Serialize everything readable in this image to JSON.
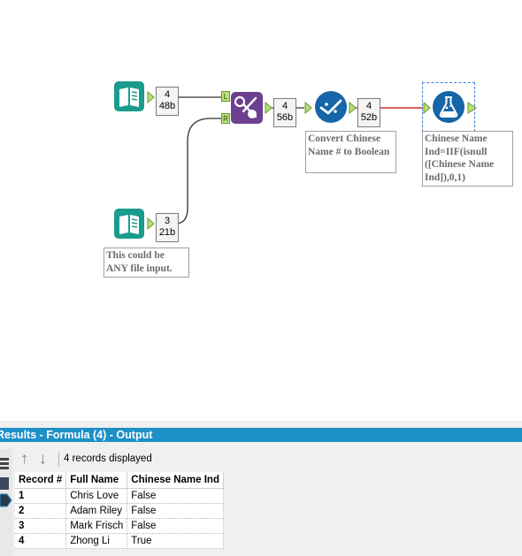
{
  "canvas": {
    "tools": [
      {
        "id": "input-1",
        "icon": "input-data-book-icon",
        "color": "#1a9c8c"
      },
      {
        "id": "input-2",
        "icon": "input-data-book-icon",
        "color": "#1a9c8c"
      },
      {
        "id": "join",
        "icon": "join-scissors-icon",
        "color": "#6c3f91"
      },
      {
        "id": "multi-field",
        "icon": "multi-field-formula-icon",
        "color": "#1565a8"
      },
      {
        "id": "formula",
        "icon": "formula-flask-icon",
        "color": "#1565a8"
      }
    ],
    "badges": {
      "input1": {
        "count": "4",
        "size": "48b"
      },
      "input2": {
        "count": "3",
        "size": "21b"
      },
      "join": {
        "count": "4",
        "size": "56b"
      },
      "multi": {
        "count": "4",
        "size": "52b"
      }
    },
    "join_anchors": {
      "left": "L",
      "right": "R"
    },
    "annotations": {
      "input2": "This could be ANY file input.",
      "multi": "Convert Chinese Name # to Boolean",
      "formula": "Chinese Name Ind=IIF(isnull ([Chinese Name Ind]),0,1)"
    }
  },
  "results": {
    "title": "Results - Formula (4) - Output",
    "records_displayed": "4 records displayed",
    "columns": [
      "Record #",
      "Full Name",
      "Chinese Name Ind"
    ],
    "rows": [
      [
        "1",
        "Chris Love",
        "False"
      ],
      [
        "2",
        "Adam Riley",
        "False"
      ],
      [
        "3",
        "Mark Frisch",
        "False"
      ],
      [
        "4",
        "Zhong Li",
        "True"
      ]
    ]
  },
  "colors": {
    "header_bar": "#1e90c8",
    "connection_selected": "#d03030",
    "selection": "#3b7fd6"
  }
}
